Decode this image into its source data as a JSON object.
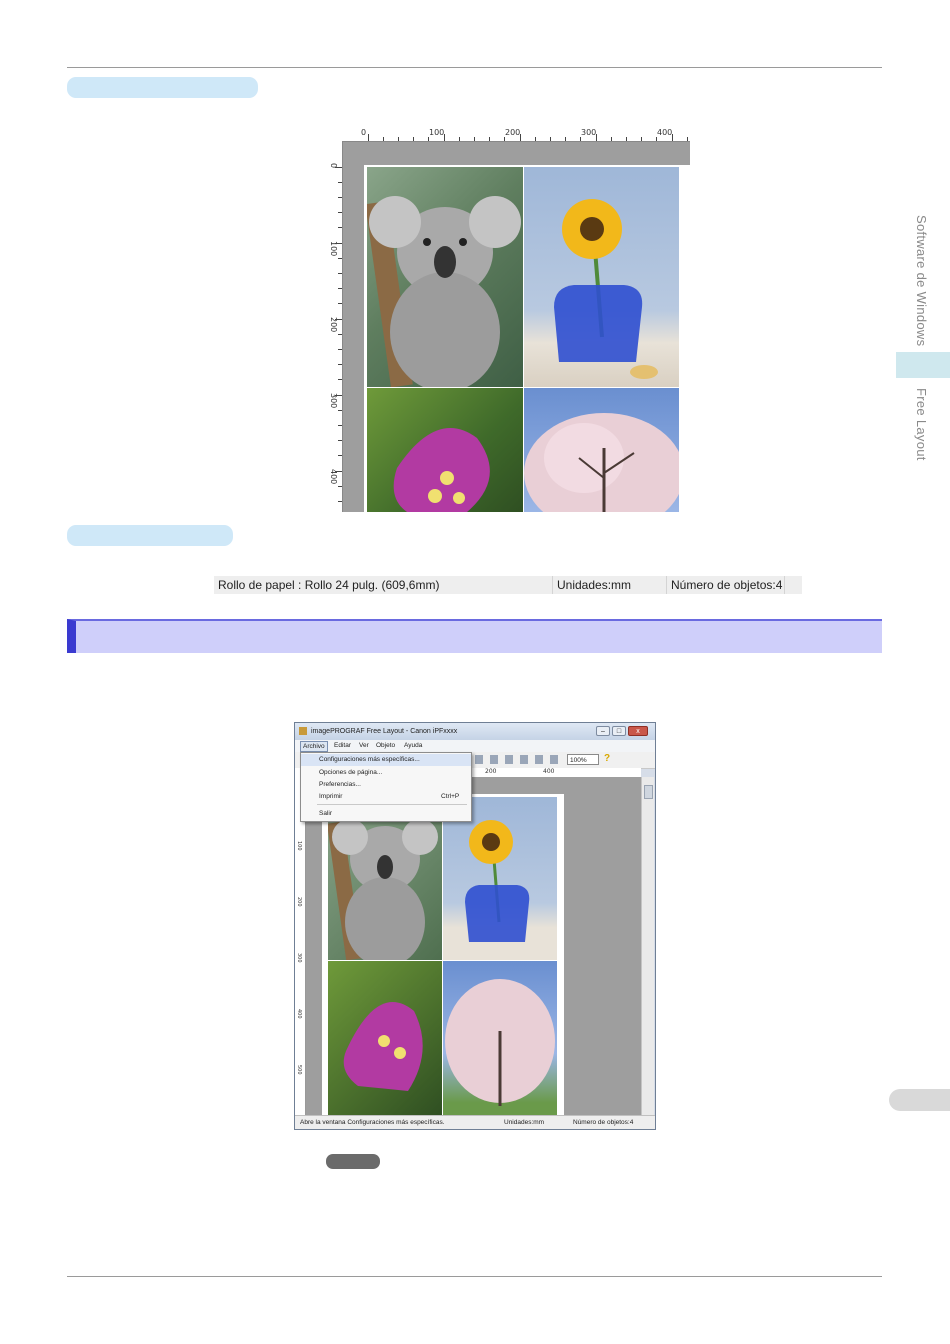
{
  "side_tab": {
    "chapter": "Software de Windows",
    "section": "Free Layout"
  },
  "figure1": {
    "ruler_top": [
      "0",
      "100",
      "200",
      "300",
      "400"
    ],
    "ruler_left": [
      "0",
      "100",
      "200",
      "300",
      "400"
    ],
    "photos": [
      "koala-photo",
      "sunflower-photo",
      "bougainvillea-photo",
      "cherry-blossom-photo"
    ]
  },
  "status_bar": {
    "paper": "Rollo de papel : Rollo 24 pulg. (609,6mm)",
    "units": "Unidades:mm",
    "objects": "Número de objetos:4"
  },
  "window": {
    "title": "imagePROGRAF Free Layout - Canon iPFxxxx",
    "menu": [
      "Archivo",
      "Editar",
      "Ver",
      "Objeto",
      "Ayuda"
    ],
    "dropdown": [
      {
        "label": "Configuraciones más específicas...",
        "shortcut": ""
      },
      {
        "label": "Opciones de página...",
        "shortcut": ""
      },
      {
        "label": "Preferencias...",
        "shortcut": ""
      },
      {
        "label": "Imprimir",
        "shortcut": "Ctrl+P"
      },
      {
        "label": "Salir",
        "shortcut": ""
      }
    ],
    "zoom": "100%",
    "ruler_top": [
      "200",
      "400"
    ],
    "ruler_left": [
      "100",
      "200",
      "300",
      "400",
      "500"
    ],
    "status": {
      "message": "Abre la ventana Configuraciones más específicas.",
      "units": "Unidades:mm",
      "objects": "Número de objetos:4"
    }
  }
}
